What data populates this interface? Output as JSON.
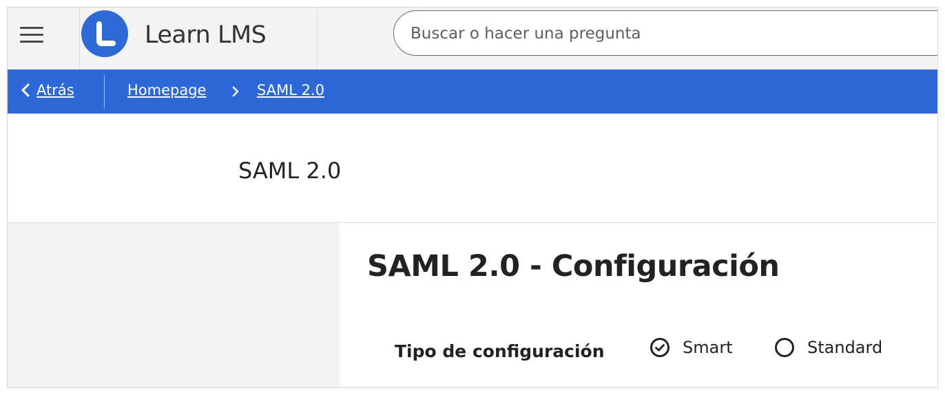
{
  "header": {
    "menu_icon": "hamburger-menu-icon",
    "brand_name": "Learn LMS",
    "logo_icon": "learn-logo-icon",
    "search": {
      "value": "",
      "placeholder": "Buscar o hacer una pregunta"
    }
  },
  "breadcrumb": {
    "back_label": "Atrás",
    "back_icon": "chevron-left-icon",
    "items": [
      "Homepage",
      "SAML 2.0"
    ],
    "separator_icon": "chevron-right-icon"
  },
  "page": {
    "title": "SAML 2.0"
  },
  "main": {
    "section_title": "SAML 2.0 - Configuración",
    "config_type": {
      "label": "Tipo de configuración",
      "options": [
        {
          "label": "Smart",
          "selected": true
        },
        {
          "label": "Standard",
          "selected": false
        }
      ]
    }
  },
  "colors": {
    "accent": "#2d68d6",
    "topbar_bg": "#f3f3f3",
    "text": "#222222"
  }
}
